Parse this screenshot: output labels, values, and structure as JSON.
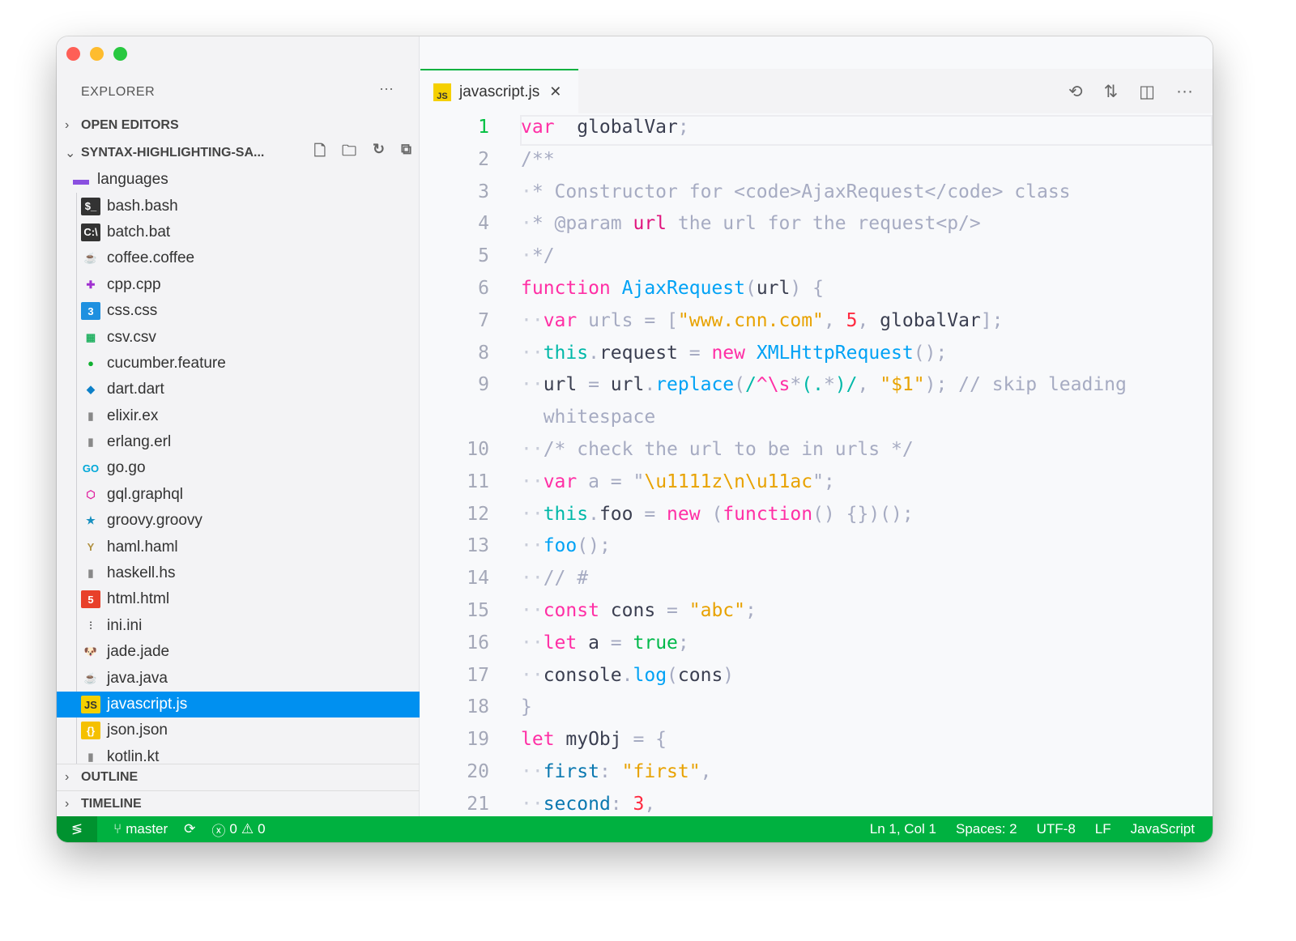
{
  "sidebar": {
    "title": "EXPLORER",
    "more": "···",
    "open_editors": "OPEN EDITORS",
    "project": "SYNTAX-HIGHLIGHTING-SA...",
    "outline": "OUTLINE",
    "timeline": "TIMELINE",
    "folder": "languages",
    "files": [
      {
        "name": "bash.bash",
        "icon": "terminal-icon",
        "glyph": "$_",
        "bg": "#333",
        "fg": "#fff"
      },
      {
        "name": "batch.bat",
        "icon": "terminal-icon",
        "glyph": "C:\\",
        "bg": "#333",
        "fg": "#fff"
      },
      {
        "name": "coffee.coffee",
        "icon": "coffee-icon",
        "glyph": "☕",
        "bg": "transparent",
        "fg": "#2a4d9a"
      },
      {
        "name": "cpp.cpp",
        "icon": "cpp-icon",
        "glyph": "✚",
        "bg": "transparent",
        "fg": "#a030d0"
      },
      {
        "name": "css.css",
        "icon": "css-icon",
        "glyph": "3",
        "bg": "#1e90e0",
        "fg": "#fff"
      },
      {
        "name": "csv.csv",
        "icon": "table-icon",
        "glyph": "▦",
        "bg": "transparent",
        "fg": "#20b060"
      },
      {
        "name": "cucumber.feature",
        "icon": "cucumber-icon",
        "glyph": "●",
        "bg": "transparent",
        "fg": "#10b030"
      },
      {
        "name": "dart.dart",
        "icon": "dart-icon",
        "glyph": "◆",
        "bg": "transparent",
        "fg": "#0d80c8"
      },
      {
        "name": "elixir.ex",
        "icon": "file-icon",
        "glyph": "▮",
        "bg": "transparent",
        "fg": "#888"
      },
      {
        "name": "erlang.erl",
        "icon": "file-icon",
        "glyph": "▮",
        "bg": "transparent",
        "fg": "#888"
      },
      {
        "name": "go.go",
        "icon": "go-icon",
        "glyph": "GO",
        "bg": "transparent",
        "fg": "#00a8d8"
      },
      {
        "name": "gql.graphql",
        "icon": "graphql-icon",
        "glyph": "⬡",
        "bg": "transparent",
        "fg": "#e020a0"
      },
      {
        "name": "groovy.groovy",
        "icon": "star-icon",
        "glyph": "★",
        "bg": "transparent",
        "fg": "#1890c0"
      },
      {
        "name": "haml.haml",
        "icon": "haml-icon",
        "glyph": "Y",
        "bg": "transparent",
        "fg": "#b09040"
      },
      {
        "name": "haskell.hs",
        "icon": "file-icon",
        "glyph": "▮",
        "bg": "transparent",
        "fg": "#888"
      },
      {
        "name": "html.html",
        "icon": "html-icon",
        "glyph": "5",
        "bg": "#e8402a",
        "fg": "#fff"
      },
      {
        "name": "ini.ini",
        "icon": "settings-icon",
        "glyph": "⫶",
        "bg": "transparent",
        "fg": "#444"
      },
      {
        "name": "jade.jade",
        "icon": "pug-icon",
        "glyph": "🐶",
        "bg": "transparent",
        "fg": "#a06030"
      },
      {
        "name": "java.java",
        "icon": "java-icon",
        "glyph": "☕",
        "bg": "transparent",
        "fg": "#1a6fc0"
      },
      {
        "name": "javascript.js",
        "icon": "js-icon",
        "glyph": "JS",
        "bg": "#f5d000",
        "fg": "#333",
        "selected": true
      },
      {
        "name": "json.json",
        "icon": "json-icon",
        "glyph": "{}",
        "bg": "#f5c000",
        "fg": "#fff"
      },
      {
        "name": "kotlin.kt",
        "icon": "file-icon",
        "glyph": "▮",
        "bg": "transparent",
        "fg": "#888"
      }
    ]
  },
  "tab": {
    "label": "javascript.js",
    "badge": "JS"
  },
  "code": [
    {
      "n": "1",
      "t": [
        [
          "k",
          "var"
        ],
        [
          "",
          "  globalVar"
        ],
        [
          "p",
          ";"
        ]
      ]
    },
    {
      "n": "2",
      "t": [
        [
          "c",
          "/**"
        ]
      ]
    },
    {
      "n": "3",
      "t": [
        [
          "ws",
          "·"
        ],
        [
          "c",
          "* Constructor for <code>AjaxRequest</code> class"
        ]
      ]
    },
    {
      "n": "4",
      "t": [
        [
          "ws",
          "·"
        ],
        [
          "c",
          "* @param "
        ],
        [
          "kd",
          "url"
        ],
        [
          "c",
          " the url for the request<p/>"
        ]
      ]
    },
    {
      "n": "5",
      "t": [
        [
          "ws",
          "·"
        ],
        [
          "c",
          "*/"
        ]
      ]
    },
    {
      "n": "6",
      "t": [
        [
          "k",
          "function"
        ],
        [
          "",
          " "
        ],
        [
          "f",
          "AjaxRequest"
        ],
        [
          "p",
          "("
        ],
        [
          "",
          "url"
        ],
        [
          "p",
          ") {"
        ]
      ]
    },
    {
      "n": "7",
      "t": [
        [
          "ws",
          "··"
        ],
        [
          "k",
          "var"
        ],
        [
          "p",
          " urls = ["
        ],
        [
          "s",
          "\"www.cnn.com\""
        ],
        [
          "p",
          ", "
        ],
        [
          "n",
          "5"
        ],
        [
          "p",
          ", "
        ],
        [
          "",
          "globalVar"
        ],
        [
          "p",
          "];"
        ]
      ]
    },
    {
      "n": "8",
      "t": [
        [
          "ws",
          "··"
        ],
        [
          "t",
          "this"
        ],
        [
          "p",
          "."
        ],
        [
          "",
          "request"
        ],
        [
          "p",
          " = "
        ],
        [
          "k",
          "new"
        ],
        [
          "",
          " "
        ],
        [
          "f",
          "XMLHttpRequest"
        ],
        [
          "p",
          "();"
        ]
      ]
    },
    {
      "n": "9",
      "t": [
        [
          "ws",
          "··"
        ],
        [
          "",
          "url"
        ],
        [
          "p",
          " = "
        ],
        [
          "",
          "url"
        ],
        [
          "p",
          "."
        ],
        [
          "f",
          "replace"
        ],
        [
          "p",
          "("
        ],
        [
          "t",
          "/"
        ],
        [
          "k",
          "^\\s"
        ],
        [
          "p",
          "*"
        ],
        [
          "t",
          "(."
        ],
        [
          "p",
          "*"
        ],
        [
          "t",
          ")/"
        ],
        [
          "p",
          ", "
        ],
        [
          "s",
          "\"$1\""
        ],
        [
          "p",
          "); "
        ],
        [
          "c",
          "// skip leading"
        ]
      ]
    },
    {
      "n": "",
      "t": [
        [
          "c",
          "  whitespace"
        ]
      ]
    },
    {
      "n": "10",
      "t": [
        [
          "ws",
          "··"
        ],
        [
          "c",
          "/* check the url to be in urls */"
        ]
      ]
    },
    {
      "n": "11",
      "t": [
        [
          "ws",
          "··"
        ],
        [
          "k",
          "var"
        ],
        [
          "p",
          " a = \""
        ],
        [
          "s",
          "\\u1111z\\n\\u11ac"
        ],
        [
          "p",
          "\";"
        ]
      ]
    },
    {
      "n": "12",
      "t": [
        [
          "ws",
          "··"
        ],
        [
          "t",
          "this"
        ],
        [
          "p",
          "."
        ],
        [
          "",
          "foo"
        ],
        [
          "p",
          " = "
        ],
        [
          "k",
          "new"
        ],
        [
          "p",
          " ("
        ],
        [
          "k",
          "function"
        ],
        [
          "p",
          "() {})();"
        ]
      ]
    },
    {
      "n": "13",
      "t": [
        [
          "ws",
          "··"
        ],
        [
          "f",
          "foo"
        ],
        [
          "p",
          "();"
        ]
      ]
    },
    {
      "n": "14",
      "t": [
        [
          "ws",
          "··"
        ],
        [
          "c",
          "// #"
        ]
      ]
    },
    {
      "n": "15",
      "t": [
        [
          "ws",
          "··"
        ],
        [
          "k",
          "const"
        ],
        [
          "",
          " cons"
        ],
        [
          "p",
          " = "
        ],
        [
          "s",
          "\"abc\""
        ],
        [
          "p",
          ";"
        ]
      ]
    },
    {
      "n": "16",
      "t": [
        [
          "ws",
          "··"
        ],
        [
          "k",
          "let"
        ],
        [
          "",
          " a"
        ],
        [
          "p",
          " = "
        ],
        [
          "b",
          "true"
        ],
        [
          "p",
          ";"
        ]
      ]
    },
    {
      "n": "17",
      "t": [
        [
          "ws",
          "··"
        ],
        [
          "",
          "console"
        ],
        [
          "p",
          "."
        ],
        [
          "f",
          "log"
        ],
        [
          "p",
          "("
        ],
        [
          "",
          "cons"
        ],
        [
          "p",
          ")"
        ]
      ]
    },
    {
      "n": "18",
      "t": [
        [
          "p",
          "}"
        ]
      ]
    },
    {
      "n": "19",
      "t": [
        [
          "k",
          "let"
        ],
        [
          "",
          " myObj"
        ],
        [
          "p",
          " = {"
        ]
      ]
    },
    {
      "n": "20",
      "t": [
        [
          "ws",
          "··"
        ],
        [
          "pr",
          "first"
        ],
        [
          "p",
          ": "
        ],
        [
          "s",
          "\"first\""
        ],
        [
          "p",
          ","
        ]
      ]
    },
    {
      "n": "21",
      "t": [
        [
          "ws",
          "··"
        ],
        [
          "pr",
          "second"
        ],
        [
          "p",
          ": "
        ],
        [
          "n",
          "3"
        ],
        [
          "p",
          ","
        ]
      ]
    }
  ],
  "status": {
    "branch": "master",
    "errors": "0",
    "warnings": "0",
    "position": "Ln 1, Col 1",
    "spaces": "Spaces: 2",
    "encoding": "UTF-8",
    "eol": "LF",
    "language": "JavaScript"
  },
  "colors": {
    "accent": "#00b140",
    "selection": "#0090f0"
  }
}
